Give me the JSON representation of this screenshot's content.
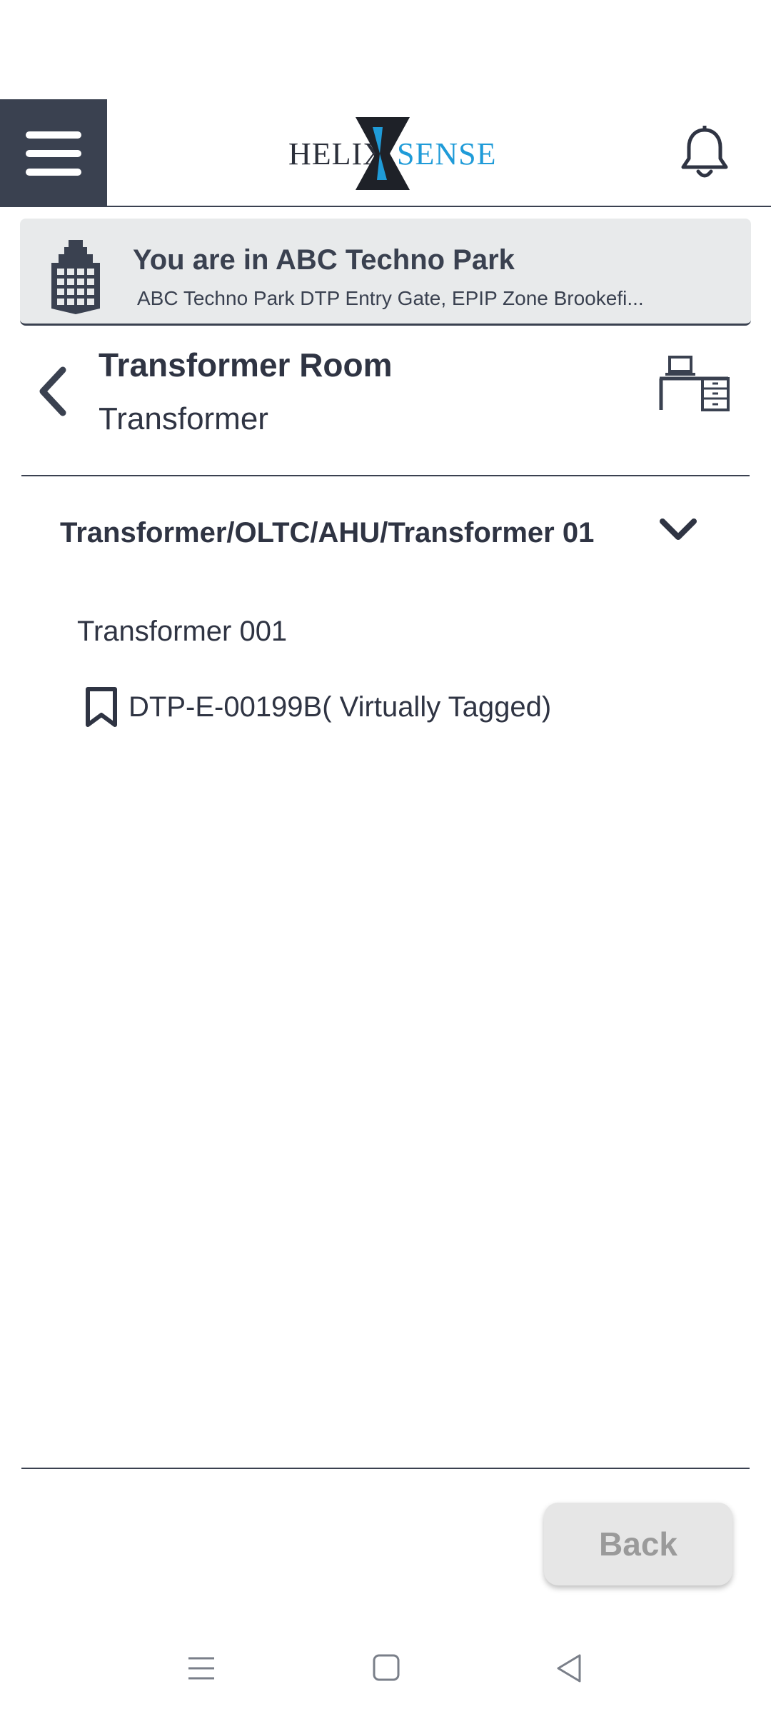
{
  "header": {
    "menu_icon": "hamburger-menu-icon",
    "logo": {
      "left_text": "HELIX",
      "right_text": "SENSE",
      "accent_color": "#1f9bd8"
    },
    "notification_icon": "bell-icon"
  },
  "location": {
    "icon": "building-icon",
    "title": "You are in ABC Techno Park",
    "address": "ABC Techno Park DTP Entry Gate, EPIP Zone Brookefi..."
  },
  "room": {
    "back_icon": "chevron-left-icon",
    "title": "Transformer Room",
    "subtitle": "Transformer",
    "workspace_icon": "desk-icon"
  },
  "asset_group": {
    "path": "Transformer/OLTC/AHU/Transformer 01",
    "expand_icon": "chevron-down-icon",
    "asset_name": "Transformer 001",
    "tag_icon": "bookmark-icon",
    "tag_text": "DTP-E-00199B( Virtually Tagged)"
  },
  "footer": {
    "back_label": "Back"
  },
  "system_nav": {
    "menu_icon": "recent-apps-icon",
    "home_icon": "home-icon",
    "back_icon": "back-triangle-icon"
  },
  "colors": {
    "primary_dark": "#3a4150",
    "banner_bg": "#e8eaeb",
    "button_bg": "#e6e6e6",
    "button_text": "#9a9a9a"
  }
}
